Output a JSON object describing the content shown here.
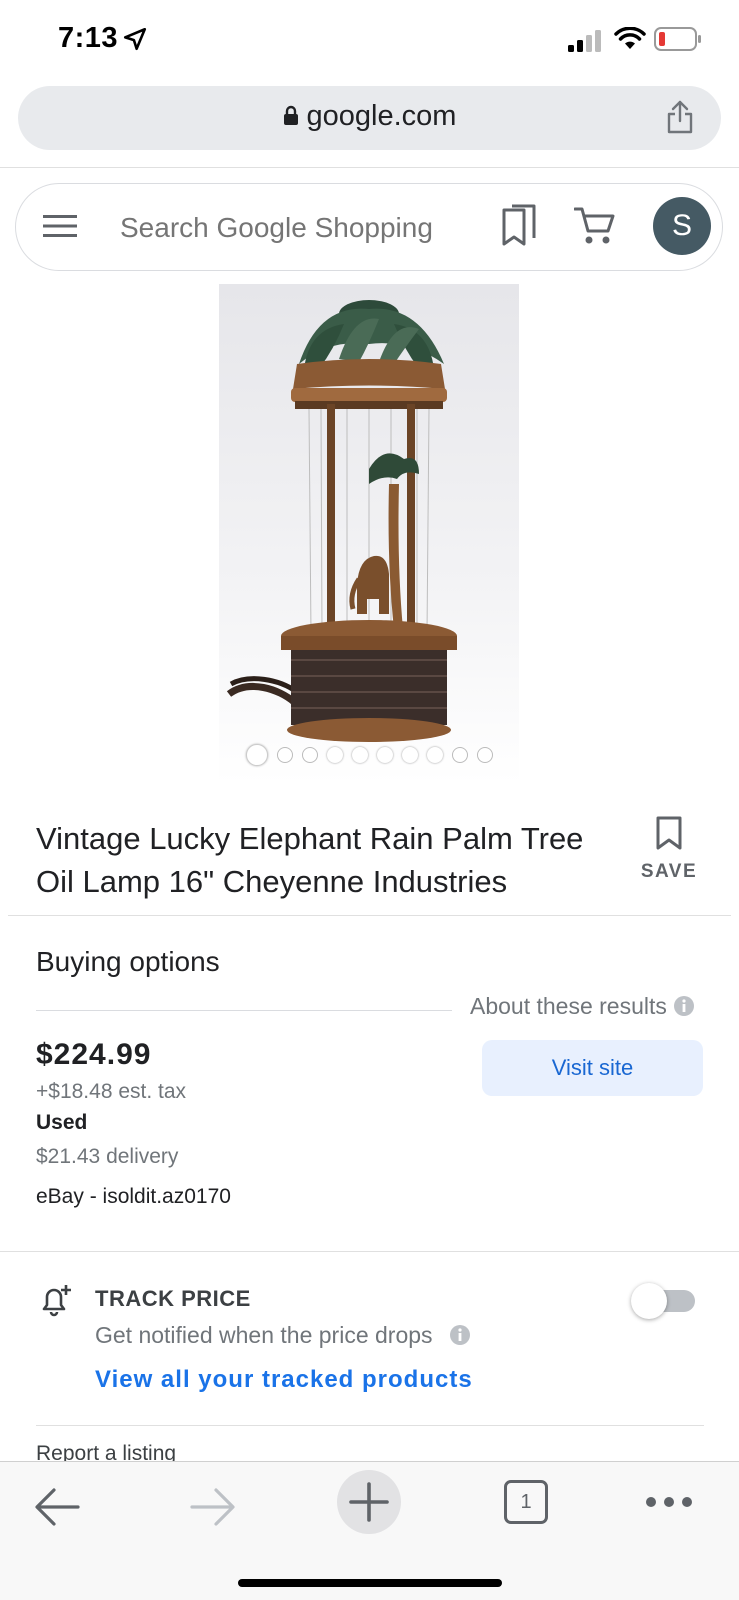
{
  "status": {
    "time": "7:13",
    "icons": [
      "location-arrow-icon",
      "signal-icon",
      "wifi-icon",
      "battery-low-icon"
    ]
  },
  "browser": {
    "url": "google.com",
    "share_icon": "share-icon"
  },
  "search": {
    "placeholder": "Search Google Shopping",
    "avatar_initial": "S"
  },
  "product": {
    "image_count": 10,
    "active_image_index": 0,
    "title": "Vintage Lucky Elephant Rain Palm Tree Oil Lamp 16\" Cheyenne Industries",
    "save_label": "SAVE"
  },
  "buying": {
    "heading": "Buying options",
    "about_results": "About these results",
    "price": "$224.99",
    "tax": "+$18.48 est. tax",
    "condition": "Used",
    "delivery": "$21.43 delivery",
    "seller": "eBay - isoldit.az0170",
    "visit_label": "Visit site"
  },
  "track": {
    "title": "TRACK PRICE",
    "subtitle": "Get notified when the price drops",
    "link": "View all your tracked products",
    "enabled": false
  },
  "footer": {
    "report": "Report a listing"
  },
  "toolbar": {
    "tab_count": "1"
  },
  "colors": {
    "accent_blue": "#1a73e8",
    "visit_bg": "#e8f0fe",
    "avatar_bg": "#455a64",
    "battery_low": "#e53935"
  }
}
